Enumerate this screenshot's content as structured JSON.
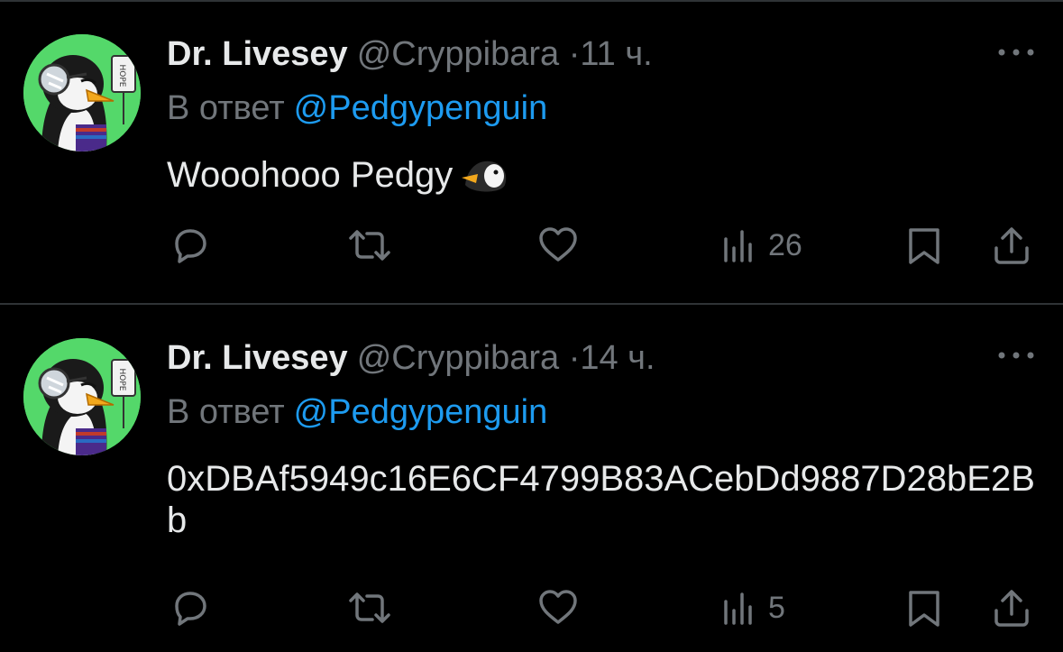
{
  "tweets": [
    {
      "display_name": "Dr. Livesey",
      "handle": "@Cryppibara",
      "separator": "·",
      "time": "11 ч.",
      "reply_prefix": "В ответ",
      "reply_to": "@Pedgypenguin",
      "text": "Wooohooo Pedgy",
      "emoji": "penguin-emoji",
      "views": "26",
      "avatar_sign": "HOPE"
    },
    {
      "display_name": "Dr. Livesey",
      "handle": "@Cryppibara",
      "separator": "·",
      "time": "14 ч.",
      "reply_prefix": "В ответ",
      "reply_to": "@Pedgypenguin",
      "text": "0xDBAf5949c16E6CF4799B83ACebDd9887D28bE2Bb",
      "views": "5",
      "avatar_sign": "HOPE"
    }
  ],
  "colors": {
    "background": "#000000",
    "primary_text": "#e7e9ea",
    "secondary_text": "#71767b",
    "mention": "#1d9bf0",
    "avatar_bg": "#54d86a",
    "divider": "#2f3336"
  },
  "icons": {
    "reply": "reply-icon",
    "retweet": "retweet-icon",
    "like": "like-icon",
    "views": "views-icon",
    "bookmark": "bookmark-icon",
    "share": "share-icon",
    "more": "more-icon"
  }
}
